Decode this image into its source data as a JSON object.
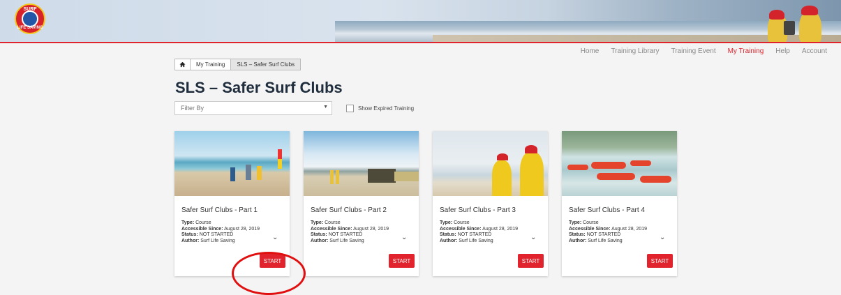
{
  "brand": {
    "logo_top": "SURF",
    "logo_bottom": "LIFE SAVING",
    "accent": "#e0232d"
  },
  "nav": [
    {
      "label": "Home",
      "active": false
    },
    {
      "label": "Training Library",
      "active": false
    },
    {
      "label": "Training Event",
      "active": false
    },
    {
      "label": "My Training",
      "active": true
    },
    {
      "label": "Help",
      "active": false
    },
    {
      "label": "Account",
      "active": false
    }
  ],
  "breadcrumb": {
    "home_icon": "home-icon",
    "items": [
      "My Training",
      "SLS – Safer Surf Clubs"
    ]
  },
  "page": {
    "title": "SLS – Safer Surf Clubs"
  },
  "filter": {
    "placeholder": "Filter By",
    "caret": "▼"
  },
  "expired": {
    "label": "Show Expired Training",
    "checked": false
  },
  "cards": [
    {
      "title": "Safer Surf Clubs - Part 1",
      "type_label": "Type:",
      "type": "Course",
      "since_label": "Accessible Since:",
      "since": "August 28, 2019",
      "status_label": "Status:",
      "status": "NOT STARTED",
      "author_label": "Author:",
      "author": "Surf Life Saving",
      "button": "START",
      "chevron": "⌄"
    },
    {
      "title": "Safer Surf Clubs - Part 2",
      "type_label": "Type:",
      "type": "Course",
      "since_label": "Accessible Since:",
      "since": "August 28, 2019",
      "status_label": "Status:",
      "status": "NOT STARTED",
      "author_label": "Author:",
      "author": "Surf Life Saving",
      "button": "START",
      "chevron": "⌄"
    },
    {
      "title": "Safer Surf Clubs - Part 3",
      "type_label": "Type:",
      "type": "Course",
      "since_label": "Accessible Since:",
      "since": "August 28, 2019",
      "status_label": "Status:",
      "status": "NOT STARTED",
      "author_label": "Author:",
      "author": "Surf Life Saving",
      "button": "START",
      "chevron": "⌄"
    },
    {
      "title": "Safer Surf Clubs - Part 4",
      "type_label": "Type:",
      "type": "Course",
      "since_label": "Accessible Since:",
      "since": "August 28, 2019",
      "status_label": "Status:",
      "status": "NOT STARTED",
      "author_label": "Author:",
      "author": "Surf Life Saving",
      "button": "START",
      "chevron": "⌄"
    }
  ]
}
